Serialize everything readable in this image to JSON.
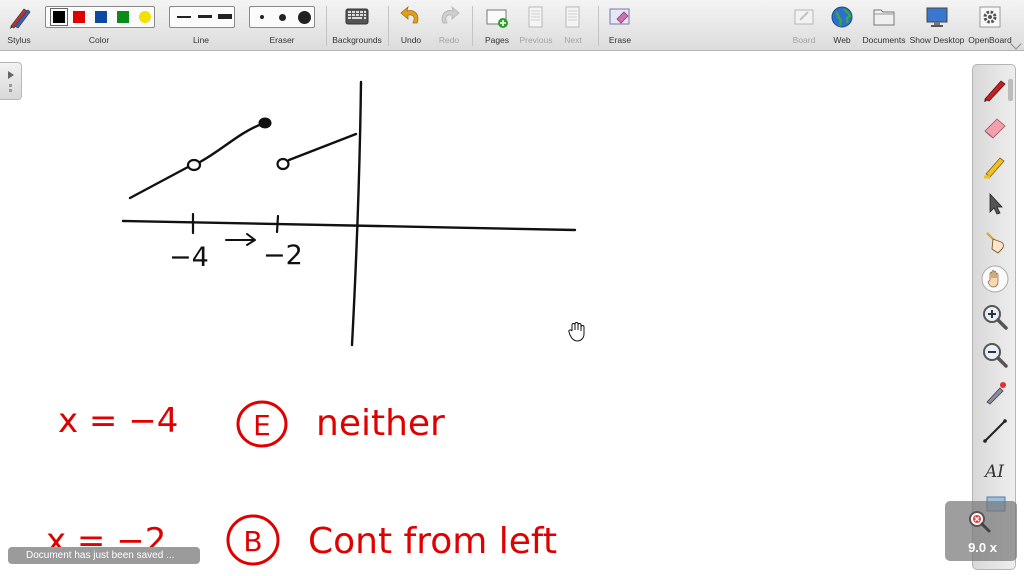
{
  "toolbar": {
    "stylus": "Stylus",
    "color": "Color",
    "line": "Line",
    "eraser": "Eraser",
    "backgrounds": "Backgrounds",
    "undo": "Undo",
    "redo": "Redo",
    "pages": "Pages",
    "previous": "Previous",
    "next": "Next",
    "erase": "Erase",
    "board": "Board",
    "web": "Web",
    "documents": "Documents",
    "show_desktop": "Show Desktop",
    "openboard": "OpenBoard",
    "colors": [
      "#000000",
      "#e00000",
      "#0a4aa0",
      "#0a8a1a",
      "#f2e000"
    ]
  },
  "board": {
    "tick_left": "−4",
    "tick_right": "−2",
    "row1_lhs": "x = −4",
    "row1_choice": "E",
    "row1_answer": "neither",
    "row2_lhs": "x = −2",
    "row2_choice": "B",
    "row2_answer": "Cont from left",
    "ink_color": "#e00000"
  },
  "zoom": "9.0 x",
  "status": "Document has just been saved ..."
}
